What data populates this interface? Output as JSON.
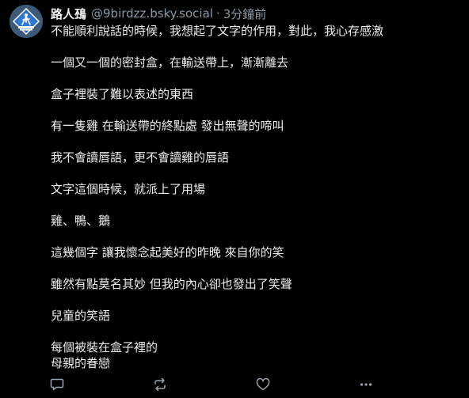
{
  "post": {
    "author": {
      "display_name": "路人䲹",
      "handle": "@9birdzz.bsky.social",
      "separator": "·",
      "timestamp": "3分鐘前",
      "avatar_icon": "crosswalk-sign-avatar"
    },
    "paragraphs": [
      "不能順利說話的時候，我想起了文字的作用，對此，我心存感激",
      "一個又一個的密封盒，在輸送帶上，漸漸離去",
      "盒子裡裝了難以表述的東西",
      "有一隻雞 在輸送帶的終點處  發出無聲的啼叫",
      "我不會讀唇語，更不會讀雞的唇語",
      "文字這個時候，就派上了用場",
      "雞、鴨、鵝",
      "這幾個字 讓我懷念起美好的昨晚  來自你的笑",
      "雖然有點莫名其妙  但我的內心卻也發出了笑聲",
      "兒童的笑語",
      "每個被裝在盒子裡的",
      "母親的眷戀"
    ],
    "actions": [
      {
        "name": "reply",
        "icon": "reply-icon"
      },
      {
        "name": "repost",
        "icon": "repost-icon"
      },
      {
        "name": "like",
        "icon": "heart-icon"
      },
      {
        "name": "more",
        "icon": "more-icon"
      }
    ],
    "colors": {
      "background": "#000000",
      "text": "#e7e9ea",
      "muted": "#8b98a5",
      "icon": "#9aa4ae"
    }
  }
}
